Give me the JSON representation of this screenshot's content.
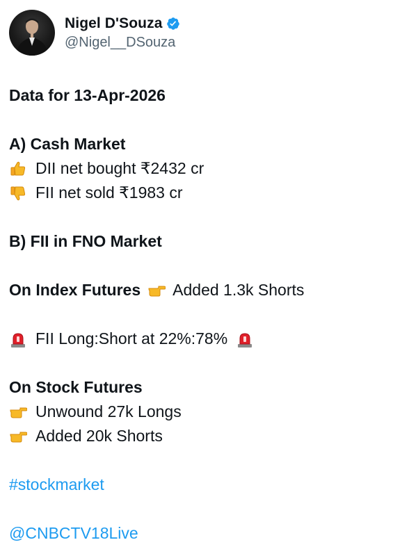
{
  "author": {
    "display_name": "Nigel D'Souza",
    "handle": "@Nigel__DSouza",
    "verified": true,
    "avatar_icon": "avatar"
  },
  "tweet": {
    "date_line": "Data for 13-Apr-2026",
    "cash_market": {
      "heading": "A) Cash Market",
      "dii": {
        "icon": "thumbs-up-icon",
        "text": "DII net bought ₹2432 cr"
      },
      "fii": {
        "icon": "thumbs-down-icon",
        "text": "FII net sold ₹1983 cr"
      }
    },
    "fno_heading": "B) FII in FNO Market",
    "index_futures": {
      "label": "On Index Futures",
      "icon": "pointing-right-icon",
      "text": "Added 1.3k Shorts"
    },
    "long_short": {
      "icon": "siren-icon",
      "text": "FII Long:Short at 22%:78%"
    },
    "stock_futures": {
      "heading": "On Stock Futures",
      "items": [
        {
          "icon": "pointing-right-icon",
          "text": "Unwound 27k Longs"
        },
        {
          "icon": "pointing-right-icon",
          "text": "Added 20k Shorts"
        }
      ]
    },
    "hashtag": "#stockmarket",
    "mention": "@CNBCTV18Live"
  },
  "colors": {
    "text": "#0f1419",
    "secondary": "#536471",
    "link": "#1d9bf0",
    "verified": "#1d9bf0"
  }
}
